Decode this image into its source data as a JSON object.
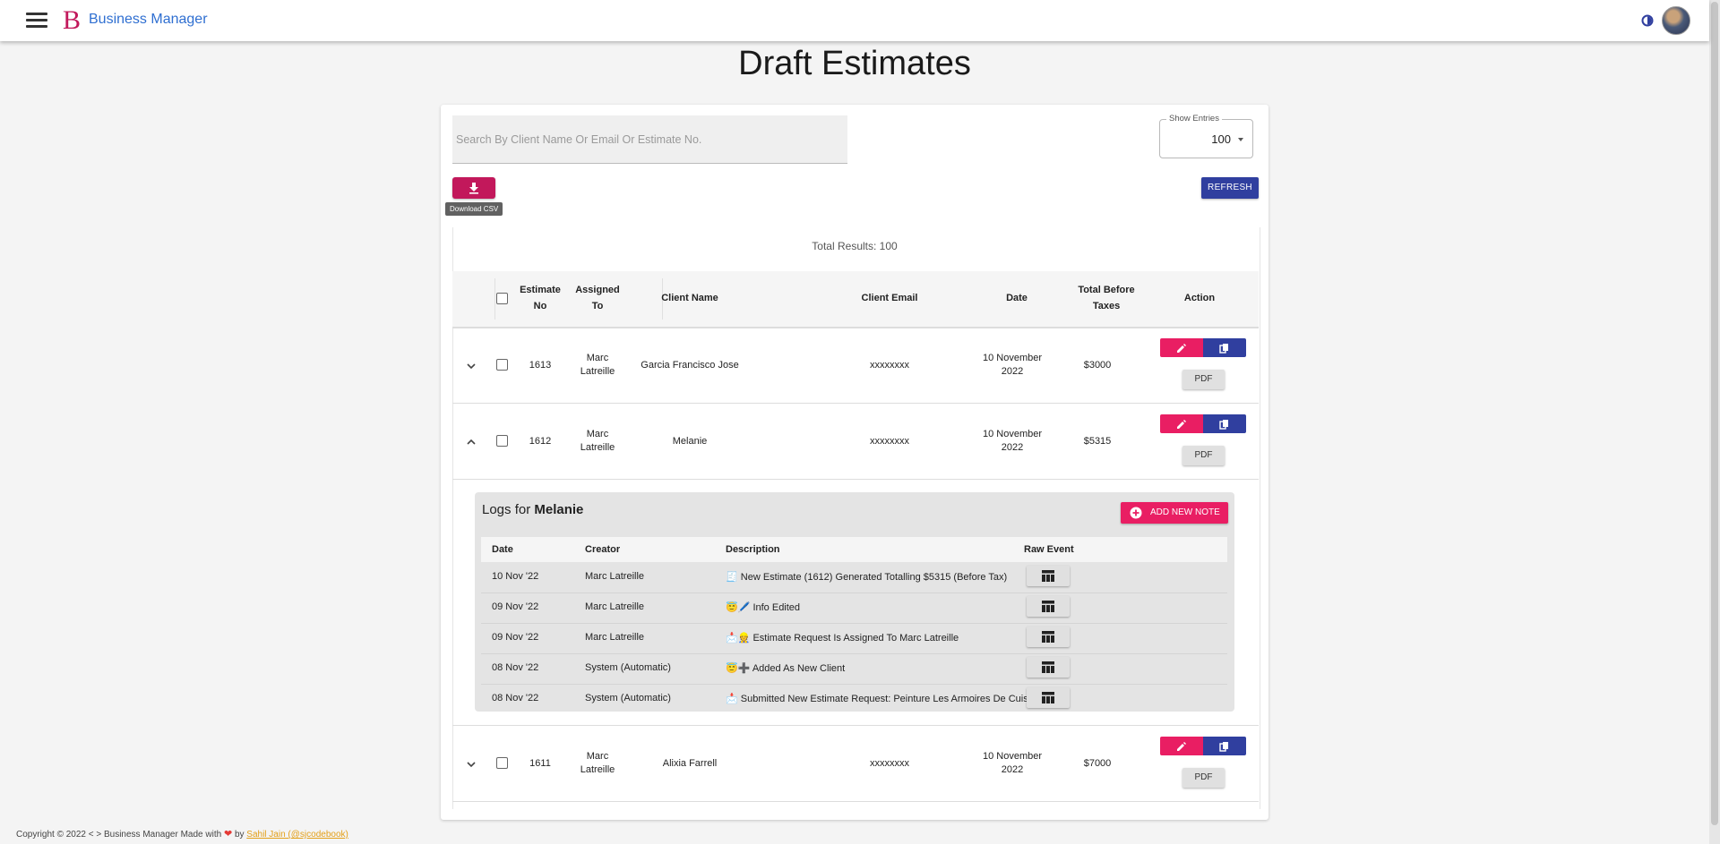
{
  "app": {
    "brand": "Business Manager",
    "logo_glyph": "B"
  },
  "page": {
    "title": "Draft Estimates"
  },
  "toolbar": {
    "search_placeholder": "Search By Client Name Or Email Or Estimate No.",
    "show_entries_label": "Show Entries",
    "show_entries_value": "100",
    "download_tooltip": "Download CSV",
    "refresh_label": "REFRESH"
  },
  "results": {
    "total_text": "Total Results: 100"
  },
  "table": {
    "headers": {
      "estimate_no": [
        "Estimate",
        "No"
      ],
      "assigned_to": [
        "Assigned",
        "To"
      ],
      "client_name": "Client Name",
      "client_email": "Client Email",
      "date": "Date",
      "total": [
        "Total Before",
        "Taxes"
      ],
      "action": "Action"
    },
    "pdf_label": "PDF",
    "rows": [
      {
        "estimate_no": "1613",
        "assigned": [
          "Marc",
          "Latreille"
        ],
        "client": "Garcia Francisco Jose",
        "email": "xxxxxxxx",
        "date": [
          "10 November",
          "2022"
        ],
        "total": "$3000",
        "expanded": false
      },
      {
        "estimate_no": "1612",
        "assigned": [
          "Marc",
          "Latreille"
        ],
        "client": "Melanie",
        "email": "xxxxxxxx",
        "date": [
          "10 November",
          "2022"
        ],
        "total": "$5315",
        "expanded": true
      },
      {
        "estimate_no": "1611",
        "assigned": [
          "Marc",
          "Latreille"
        ],
        "client": "Alixia Farrell",
        "email": "xxxxxxxx",
        "date": [
          "10 November",
          "2022"
        ],
        "total": "$7000",
        "expanded": false
      }
    ]
  },
  "logs": {
    "title_prefix": "Logs for",
    "client": "Melanie",
    "add_note_label": "ADD NEW NOTE",
    "headers": {
      "date": "Date",
      "creator": "Creator",
      "description": "Description",
      "raw": "Raw Event"
    },
    "rows": [
      {
        "date": "10 Nov '22",
        "creator": "Marc Latreille",
        "description": "🧾 New Estimate (1612) Generated Totalling $5315 (Before Tax)"
      },
      {
        "date": "09 Nov '22",
        "creator": "Marc Latreille",
        "description": "😇🖊️ Info Edited"
      },
      {
        "date": "09 Nov '22",
        "creator": "Marc Latreille",
        "description": "📩👷 Estimate Request Is Assigned To Marc Latreille"
      },
      {
        "date": "08 Nov '22",
        "creator": "System (Automatic)",
        "description": "😇➕ Added As New Client"
      },
      {
        "date": "08 Nov '22",
        "creator": "System (Automatic)",
        "description": "📩 Submitted New Estimate Request: Peinture Les Armoires De Cuisine"
      }
    ]
  },
  "footer": {
    "text": "Copyright © 2022  < >  Business Manager Made with",
    "by": "by",
    "author": "Sahil Jain (@sjcodebook)"
  },
  "colors": {
    "primary_pink": "#e91e63",
    "primary_blue": "#303f9f",
    "brand_blue": "#2f6fd1"
  },
  "icons": [
    "menu-icon",
    "theme-toggle-icon",
    "download-icon",
    "edit-icon",
    "copy-icon",
    "chevron-down-icon",
    "chevron-up-icon",
    "add-circle-icon",
    "table-icon",
    "heart-icon"
  ]
}
